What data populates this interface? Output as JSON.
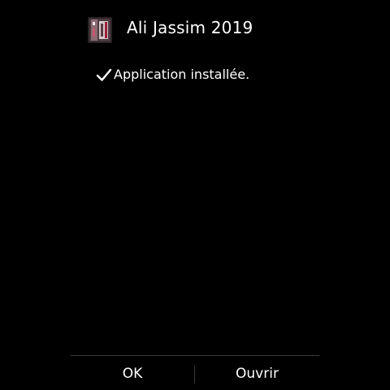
{
  "app": {
    "name": "Ali Jassim 2019",
    "icon": "app-icon"
  },
  "status": {
    "icon": "check-icon",
    "message": "Application installée."
  },
  "buttons": {
    "ok_label": "OK",
    "open_label": "Ouvrir"
  }
}
